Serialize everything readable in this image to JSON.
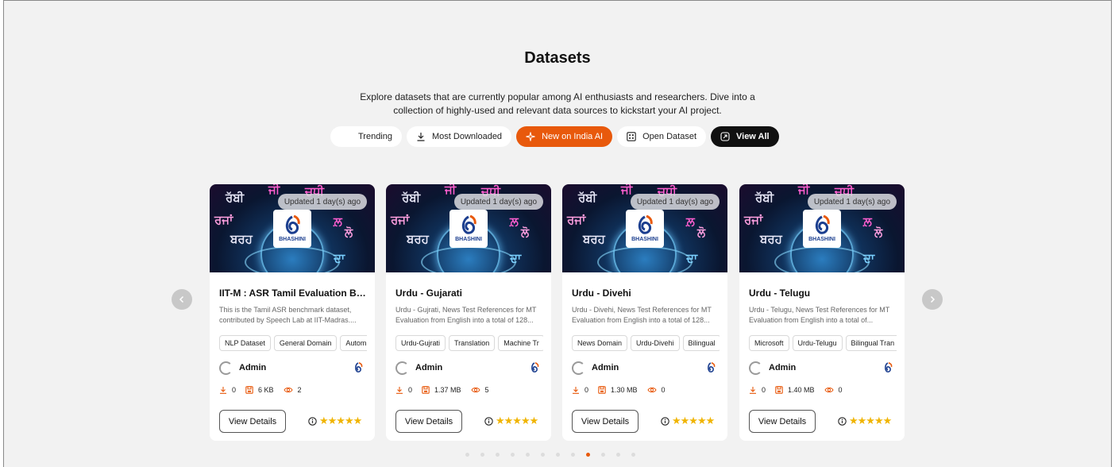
{
  "header": {
    "title": "Datasets",
    "subtitle": "Explore datasets that are currently popular among AI enthusiasts and researchers. Dive into a collection of highly-used and relevant data sources to kickstart your AI project."
  },
  "tabs": [
    {
      "label": "Trending",
      "icon": "trending-icon"
    },
    {
      "label": "Most Downloaded",
      "icon": "download-icon"
    },
    {
      "label": "New on India AI",
      "icon": "sparkle-icon",
      "active": true
    },
    {
      "label": "Open Dataset",
      "icon": "grid-icon"
    },
    {
      "label": "View All",
      "icon": "external-link-icon"
    }
  ],
  "colors": {
    "accent": "#e8590c",
    "star": "#f0b400"
  },
  "banner": {
    "brand": "BHASHINI"
  },
  "cards": [
    {
      "updated": "Updated 1 day(s) ago",
      "title": "IIT-M : ASR Tamil Evaluation Be...",
      "description": "This is the Tamil ASR benchmark dataset, contributed by Speech Lab at IIT-Madras....",
      "tags": [
        "NLP Dataset",
        "General Domain",
        "Autom"
      ],
      "author": "Admin",
      "downloads": "0",
      "size": "6 KB",
      "views": "2",
      "button": "View Details"
    },
    {
      "updated": "Updated 1 day(s) ago",
      "title": "Urdu - Gujarati",
      "description": "Urdu - Gujrati, News Test References for MT Evaluation from English into a total of 128...",
      "tags": [
        "Urdu-Gujrati",
        "Translation",
        "Machine Tr"
      ],
      "author": "Admin",
      "downloads": "0",
      "size": "1.37 MB",
      "views": "5",
      "button": "View Details"
    },
    {
      "updated": "Updated 1 day(s) ago",
      "title": "Urdu - Divehi",
      "description": "Urdu - Divehi, News Test References for MT Evaluation from English into a total of 128...",
      "tags": [
        "News Domain",
        "Urdu-Divehi",
        "Bilingual"
      ],
      "author": "Admin",
      "downloads": "0",
      "size": "1.30 MB",
      "views": "0",
      "button": "View Details"
    },
    {
      "updated": "Updated 1 day(s) ago",
      "title": "Urdu - Telugu",
      "description": "Urdu - Telugu, News Test References for MT Evaluation from English into a total of...",
      "tags": [
        "Microsoft",
        "Urdu-Telugu",
        "Bilingual Tran"
      ],
      "author": "Admin",
      "downloads": "0",
      "size": "1.40 MB",
      "views": "0",
      "button": "View Details"
    }
  ],
  "pagination": {
    "count": 12,
    "active_index": 8
  }
}
